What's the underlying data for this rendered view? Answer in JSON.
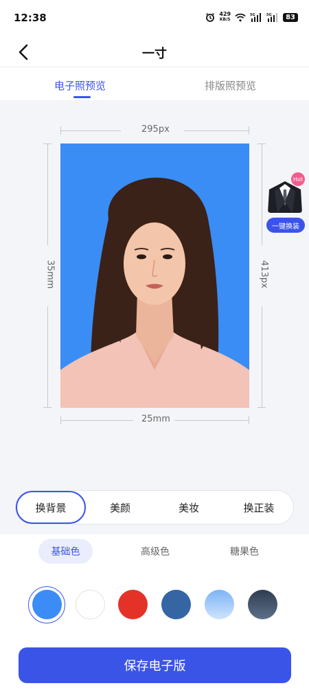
{
  "status_bar": {
    "time": "12:38",
    "net_speed_value": "429",
    "net_speed_unit": "KB/S",
    "battery": "83",
    "icons": [
      "alarm-icon",
      "wifi-icon",
      "5g-signal-icon",
      "5g-signal-icon",
      "battery-icon"
    ]
  },
  "header": {
    "title": "一寸",
    "back_icon": "chevron-left-icon"
  },
  "tabs": {
    "active": "电子照预览",
    "inactive": "排版照预览"
  },
  "canvas": {
    "width_px_label": "295px",
    "height_mm_label": "35mm",
    "height_px_label": "413px",
    "width_mm_label": "25mm",
    "photo_background": "#3a8df5"
  },
  "suit": {
    "badge": "Hot",
    "button_label": "一键换装"
  },
  "tools": {
    "items": [
      "换背景",
      "美颜",
      "美妆",
      "换正装"
    ],
    "active_index": 0
  },
  "color_categories": {
    "items": [
      "基础色",
      "高级色",
      "糖果色"
    ],
    "active_index": 0
  },
  "swatches": {
    "colors": [
      "#3b8cf7",
      "#ffffff",
      "#e53228",
      "#3565a3",
      "linear-gradient(#7db4f6,#cfe3fc)",
      "linear-gradient(#2f3d52,#5d7088)"
    ],
    "selected_index": 0
  },
  "actions": {
    "save_label": "保存电子版"
  },
  "accent_color": "#3b54e8"
}
